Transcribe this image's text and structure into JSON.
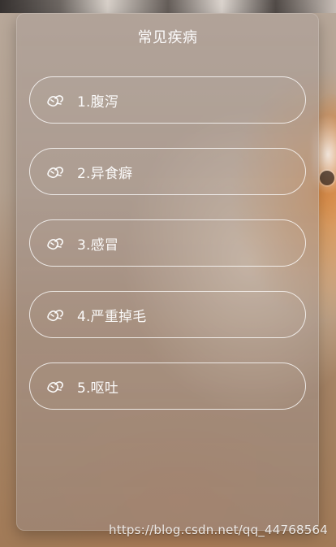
{
  "card": {
    "title": "常见疾病"
  },
  "items": [
    {
      "label": "1.腹泻",
      "icon": "paw-icon"
    },
    {
      "label": "2.异食癖",
      "icon": "paw-icon"
    },
    {
      "label": "3.感冒",
      "icon": "paw-icon"
    },
    {
      "label": "4.严重掉毛",
      "icon": "paw-icon"
    },
    {
      "label": "5.呕吐",
      "icon": "paw-icon"
    }
  ],
  "watermark": {
    "text": "https://blog.csdn.net/qq_44768564"
  },
  "colors": {
    "text": "#ffffff",
    "card_bg": "rgba(150,132,122,0.55)",
    "outline": "rgba(255,255,255,0.78)"
  }
}
